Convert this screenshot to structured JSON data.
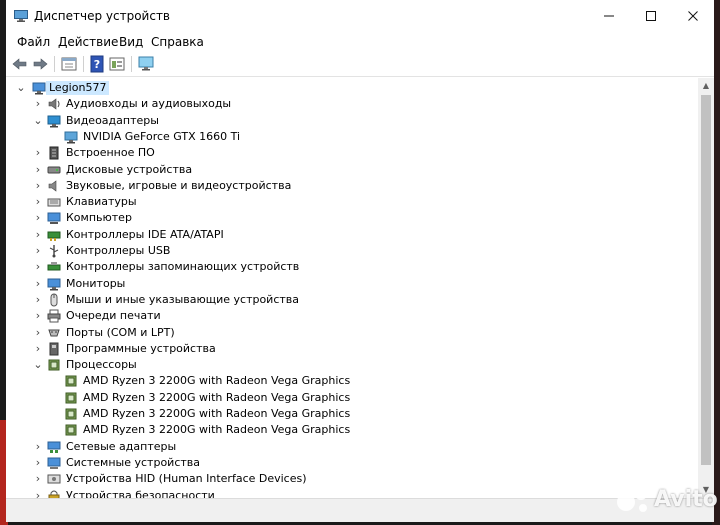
{
  "window": {
    "title": "Диспетчер устройств",
    "minimize": "—",
    "maximize": "☐",
    "close": "✕"
  },
  "menu": [
    "Файл",
    "Действие",
    "Вид",
    "Справка"
  ],
  "toolbar": [
    "back-icon",
    "forward-icon",
    "properties-icon",
    "help-icon",
    "view-icon",
    "monitor-scan-icon"
  ],
  "tree": {
    "root": "Legion577",
    "items": [
      {
        "label": "Аудиовходы и аудиовыходы",
        "icon": "audio-io-icon",
        "state": "collapsed",
        "children": []
      },
      {
        "label": "Видеоадаптеры",
        "icon": "display-adapter-icon",
        "state": "expanded",
        "children": [
          "NVIDIA GeForce GTX 1660 Ti"
        ]
      },
      {
        "label": "Встроенное ПО",
        "icon": "firmware-icon",
        "state": "collapsed",
        "children": []
      },
      {
        "label": "Дисковые устройства",
        "icon": "disk-drive-icon",
        "state": "collapsed",
        "children": []
      },
      {
        "label": "Звуковые, игровые и видеоустройства",
        "icon": "speaker-icon",
        "state": "collapsed",
        "children": []
      },
      {
        "label": "Клавиатуры",
        "icon": "keyboard-icon",
        "state": "collapsed",
        "children": []
      },
      {
        "label": "Компьютер",
        "icon": "computer-icon",
        "state": "collapsed",
        "children": []
      },
      {
        "label": "Контроллеры IDE ATA/ATAPI",
        "icon": "ide-controller-icon",
        "state": "collapsed",
        "children": []
      },
      {
        "label": "Контроллеры USB",
        "icon": "usb-icon",
        "state": "collapsed",
        "children": []
      },
      {
        "label": "Контроллеры запоминающих устройств",
        "icon": "storage-controller-icon",
        "state": "collapsed",
        "children": []
      },
      {
        "label": "Мониторы",
        "icon": "monitor-icon",
        "state": "collapsed",
        "children": []
      },
      {
        "label": "Мыши и иные указывающие устройства",
        "icon": "mouse-icon",
        "state": "collapsed",
        "children": []
      },
      {
        "label": "Очереди печати",
        "icon": "printer-icon",
        "state": "collapsed",
        "children": []
      },
      {
        "label": "Порты (COM и LPT)",
        "icon": "port-icon",
        "state": "collapsed",
        "children": []
      },
      {
        "label": "Программные устройства",
        "icon": "software-device-icon",
        "state": "collapsed",
        "children": []
      },
      {
        "label": "Процессоры",
        "icon": "processor-icon",
        "state": "expanded",
        "children": [
          "AMD Ryzen 3 2200G with Radeon Vega Graphics",
          "AMD Ryzen 3 2200G with Radeon Vega Graphics",
          "AMD Ryzen 3 2200G with Radeon Vega Graphics",
          "AMD Ryzen 3 2200G with Radeon Vega Graphics"
        ]
      },
      {
        "label": "Сетевые адаптеры",
        "icon": "network-adapter-icon",
        "state": "collapsed",
        "children": []
      },
      {
        "label": "Системные устройства",
        "icon": "system-device-icon",
        "state": "collapsed",
        "children": []
      },
      {
        "label": "Устройства HID (Human Interface Devices)",
        "icon": "hid-icon",
        "state": "collapsed",
        "children": []
      },
      {
        "label": "Устройства безопасности",
        "icon": "security-device-icon",
        "state": "collapsed",
        "children": []
      }
    ]
  },
  "watermark": {
    "text": "Avito",
    "icon": "avito-logo-icon"
  },
  "colors": {
    "selection": "#cce8ff",
    "accent": "#0078d7",
    "background": "#ffffff"
  }
}
